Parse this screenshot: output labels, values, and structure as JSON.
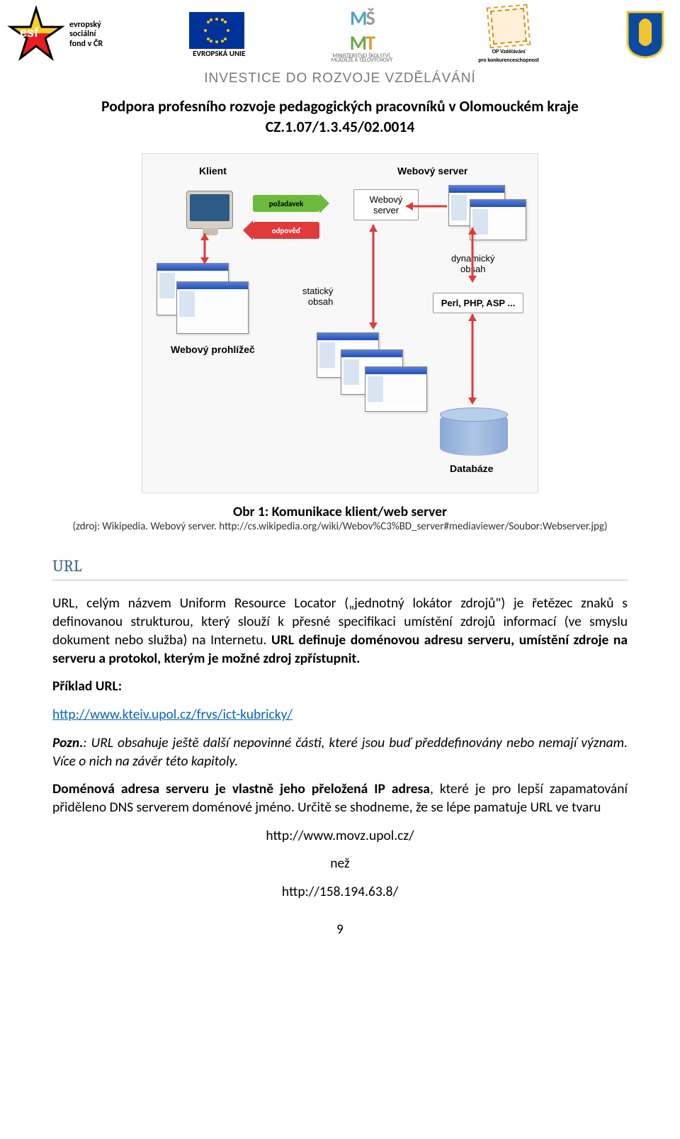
{
  "header": {
    "esf_line1": "evropský",
    "esf_line2": "sociální",
    "esf_line3": "fond v ČR",
    "eu_label": "EVROPSKÁ UNIE",
    "msmt_line1": "MINISTERSTVO ŠKOLSTVÍ,",
    "msmt_line2": "MLÁDEŽE A TĚLOVÝCHOVY",
    "opvk_line1": "OP Vzdělávání",
    "opvk_line2": "pro konkurenceschopnost",
    "investice": "INVESTICE DO ROZVOJE VZDĚLÁVÁNÍ",
    "project_title_l1": "Podpora profesního rozvoje pedagogických pracovníků v Olomouckém kraje",
    "project_title_l2": "CZ.1.07/1.3.45/02.0014"
  },
  "diagram": {
    "klient": "Klient",
    "webovy_server": "Webový server",
    "pozadavek": "požadavek",
    "odpoved": "odpověď",
    "webovy_server_box": "Webový\nserver",
    "staticky_obsah": "statický\nobsah",
    "dynamicky_obsah": "dynamický\nobsah",
    "perl_php_asp": "Perl, PHP, ASP ...",
    "webovy_prohlizec": "Webový prohlížeč",
    "databaze": "Databáze"
  },
  "caption": {
    "title": "Obr 1: ",
    "text": "Komunikace klient/web server",
    "source": "(zdroj: Wikipedia. Webový server. http://cs.wikipedia.org/wiki/Webov%C3%BD_server#mediaviewer/Soubor:Webserver.jpg)"
  },
  "section": {
    "url_heading": "URL"
  },
  "body": {
    "p1_a": "URL, celým názvem Uniform Resource Locator („jednotný lokátor zdrojů\") je řetězec znaků s definovanou strukturou, který slouží k přesné specifikaci umístění zdrojů informací (ve smyslu dokument nebo služba) na Internetu. ",
    "p1_b": "URL definuje doménovou adresu serveru, umístění zdroje na serveru a protokol, kterým je možné zdroj zpřístupnit.",
    "p2": "Příklad URL:",
    "p3_link": "http://www.kteiv.upol.cz/frvs/ict-kubricky/",
    "p4_a": "Pozn.",
    "p4_b": ": URL obsahuje ještě další nepovinné části, které jsou buď předdefinovány nebo nemají význam. Více o nich na závěr této kapitoly.",
    "p5_a": "Doménová adresa serveru je vlastně jeho přeložená IP adresa",
    "p5_b": ", které je pro lepší zapamatování přiděleno DNS serverem doménové jméno. Určitě se shodneme, že se lépe pamatuje URL ve tvaru",
    "url1": "http://www.movz.upol.cz/",
    "nez": "než",
    "url2": "http://158.194.63.8/"
  },
  "footer": {
    "page_number": "9"
  }
}
